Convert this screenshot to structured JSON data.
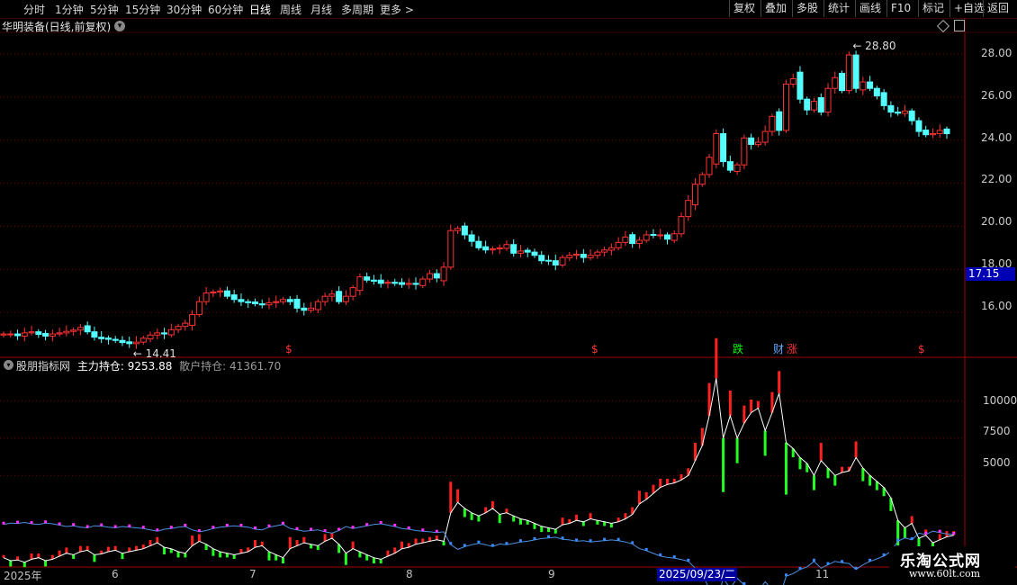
{
  "toolbar": {
    "left": [
      "分时",
      "1分钟",
      "5分钟",
      "15分钟",
      "30分钟",
      "60分钟",
      "日线",
      "周线",
      "月线",
      "多周期",
      "更多 >"
    ],
    "active": "日线",
    "right": [
      "复权",
      "叠加",
      "多股",
      "统计",
      "画线",
      "F10",
      "标记",
      "+自选",
      "返回"
    ]
  },
  "main_title": "华明装备(日线,前复权)",
  "indicator": {
    "name": "股朋指标网",
    "main_label": "主力持仓:",
    "main_value": "9253.88",
    "retail_label": "散户持仓:",
    "retail_value": "41361.70"
  },
  "price_axis": [
    "28.00",
    "26.00",
    "24.00",
    "22.00",
    "20.00",
    "18.00",
    "16.00"
  ],
  "indicator_axis": [
    "10000",
    "7500",
    "5000"
  ],
  "current_price": "17.15",
  "high_marker": "28.80",
  "low_marker": "14.41",
  "date_axis": [
    "2025年",
    "6",
    "7",
    "8",
    "9",
    "11"
  ],
  "date_highlight": "2025/09/23/二",
  "events": [
    {
      "text": "$",
      "color": "#ff3333"
    },
    {
      "text": "$",
      "color": "#ff3333"
    },
    {
      "text": "跌",
      "color": "#00ff00"
    },
    {
      "text": "财",
      "color": "#66aaff"
    },
    {
      "text": "涨",
      "color": "#ff3333"
    },
    {
      "text": "$",
      "color": "#ff3333"
    }
  ],
  "watermark": {
    "line1": "乐淘公式网",
    "line2": "www.60lt.com"
  },
  "colors": {
    "up": "#ff3333",
    "down": "#54ffff",
    "main_line": "#ffffff",
    "retail_line": "#4a90e2",
    "grid": "#7a0000"
  },
  "chart_data": {
    "type": "candlestick",
    "ylim": [
      14.0,
      29.0
    ],
    "indicator_ylim": [
      -1000,
      12000
    ],
    "high": 28.8,
    "low": 14.41,
    "closes": [
      15.0,
      15.0,
      14.92,
      15.05,
      15.1,
      14.98,
      14.9,
      15.0,
      15.05,
      15.12,
      15.18,
      15.3,
      15.1,
      14.85,
      14.78,
      14.75,
      14.7,
      14.6,
      14.55,
      14.62,
      14.8,
      14.95,
      15.05,
      15.0,
      15.2,
      15.35,
      15.5,
      15.9,
      16.5,
      16.9,
      16.95,
      17.0,
      16.75,
      16.6,
      16.5,
      16.45,
      16.4,
      16.35,
      16.45,
      16.5,
      16.6,
      16.5,
      16.2,
      16.1,
      16.2,
      16.5,
      16.75,
      16.85,
      16.5,
      16.75,
      17.15,
      17.65,
      17.5,
      17.45,
      17.35,
      17.4,
      17.35,
      17.3,
      17.35,
      17.3,
      17.55,
      17.8,
      17.6,
      18.1,
      19.8,
      19.9,
      19.6,
      19.3,
      19.0,
      18.9,
      18.95,
      19.0,
      19.15,
      18.75,
      18.85,
      18.8,
      18.65,
      18.4,
      18.4,
      18.2,
      18.55,
      18.65,
      18.7,
      18.55,
      18.65,
      18.8,
      18.9,
      19.0,
      19.25,
      19.5,
      19.2,
      19.35,
      19.6,
      19.6,
      19.6,
      19.4,
      19.65,
      20.45,
      21.2,
      21.95,
      22.4,
      23.2,
      24.3,
      23.0,
      22.6,
      22.85,
      24.1,
      23.8,
      23.9,
      24.4,
      25.1,
      24.45,
      26.6,
      26.85,
      25.9,
      25.4,
      25.8,
      25.3,
      26.4,
      26.9,
      26.3,
      27.95,
      26.4,
      26.7,
      26.4,
      26.05,
      25.6,
      25.3,
      25.25,
      25.35,
      24.9,
      24.4,
      24.25,
      24.3,
      24.45,
      24.3
    ],
    "main_position": [
      -500,
      -700,
      -650,
      -800,
      -600,
      -500,
      -700,
      -600,
      -400,
      -200,
      -300,
      -100,
      0,
      -300,
      -250,
      -100,
      0,
      -200,
      -100,
      0,
      100,
      300,
      500,
      200,
      100,
      -100,
      -200,
      300,
      600,
      400,
      100,
      -100,
      -200,
      -300,
      -200,
      -100,
      200,
      300,
      -100,
      -300,
      -500,
      100,
      300,
      500,
      400,
      300,
      600,
      800,
      400,
      -200,
      100,
      -100,
      -300,
      -500,
      -600,
      -400,
      -200,
      100,
      200,
      400,
      500,
      600,
      700,
      600,
      2500,
      3200,
      2800,
      2500,
      2300,
      2500,
      2800,
      2400,
      2500,
      2300,
      2100,
      2000,
      1800,
      1600,
      1500,
      1400,
      1700,
      1800,
      2000,
      1900,
      2100,
      2000,
      1900,
      1800,
      1900,
      2100,
      2400,
      3100,
      3400,
      3800,
      4200,
      4400,
      4500,
      4700,
      5000,
      6000,
      7000,
      9000,
      11500,
      7500,
      9000,
      7500,
      8500,
      9200,
      9500,
      8000,
      9200,
      10500,
      7200,
      6800,
      6200,
      5800,
      5000,
      6000,
      5500,
      5000,
      5200,
      5300,
      6200,
      5500,
      5000,
      4600,
      4200,
      3500,
      2000,
      1500,
      1800,
      800,
      1000,
      500,
      700,
      900,
      1000
    ]
  }
}
